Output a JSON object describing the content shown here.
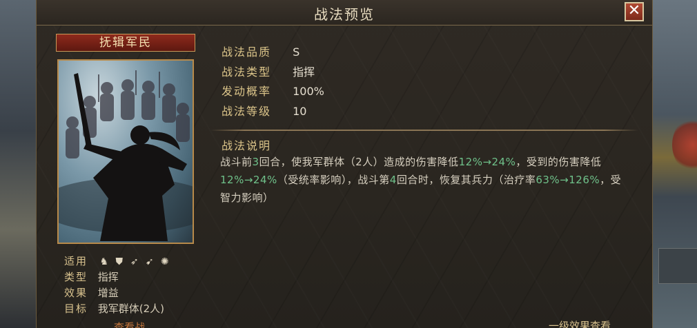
{
  "dialog": {
    "title": "战法预览",
    "close_glyph": "✕"
  },
  "card": {
    "name": "抚辑军民"
  },
  "props": [
    {
      "label": "战法品质",
      "value": "S"
    },
    {
      "label": "战法类型",
      "value": "指挥"
    },
    {
      "label": "发动概率",
      "value": "100%"
    },
    {
      "label": "战法等级",
      "value": "10"
    }
  ],
  "description": {
    "heading": "战法说明",
    "p1": "战斗前",
    "n1": "3",
    "p2": "回合，使我军群体（2人）造成的伤害降低",
    "n2": "12%→24%",
    "p3": "，受到的伤害降低",
    "n3": "12%→24%",
    "p4": "（受统率影响），战斗第",
    "n4": "4",
    "p5": "回合时，恢复其兵力（治疗率",
    "n5": "63%→126%",
    "p6": "，受智力影响）"
  },
  "meta": {
    "applies_label": "适用",
    "applies_icons": [
      "cavalry-icon",
      "shield-icon",
      "bow-icon",
      "spear-icon",
      "siege-icon"
    ],
    "type_label": "类型",
    "type_value": "指挥",
    "effect_label": "效果",
    "effect_value": "增益",
    "target_label": "目标",
    "target_value": "我军群体(2人)"
  },
  "footer": {
    "left_text": "查看战",
    "right_text": "一级效果查看"
  },
  "colors": {
    "highlight": "#6fc18a",
    "label_gold": "#dcc58a",
    "title_red": "#8e2a1c"
  }
}
